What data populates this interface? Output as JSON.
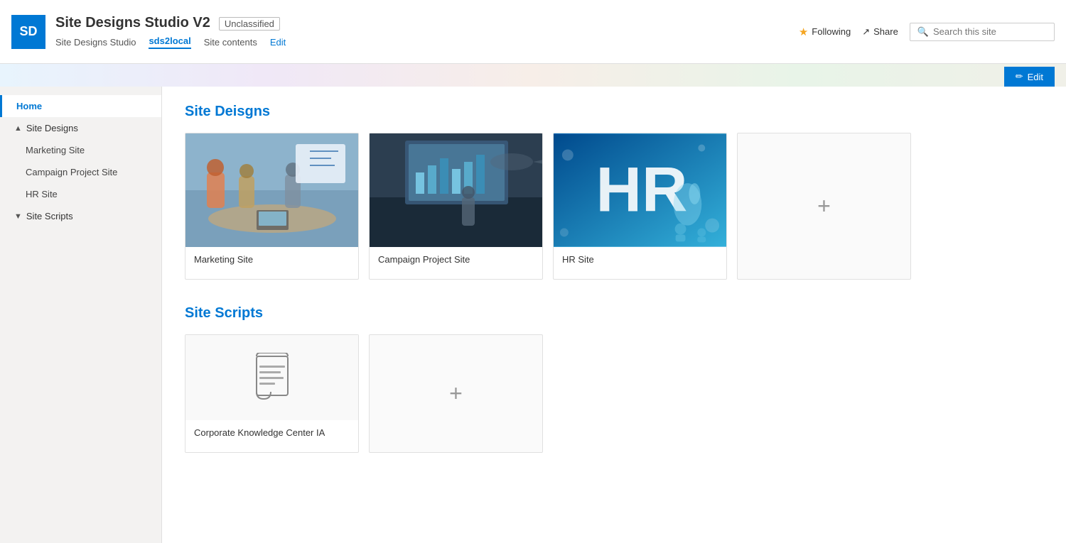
{
  "topBar": {
    "logoText": "SD",
    "logoColor": "#0078d4",
    "siteTitle": "Site Designs Studio V2",
    "siteTag": "Unclassified",
    "navItems": [
      {
        "label": "Site Designs Studio",
        "active": false,
        "edit": false
      },
      {
        "label": "sds2local",
        "active": true,
        "edit": false
      },
      {
        "label": "Site contents",
        "active": false,
        "edit": false
      },
      {
        "label": "Edit",
        "active": false,
        "edit": true
      }
    ],
    "followingLabel": "Following",
    "shareLabel": "Share",
    "searchPlaceholder": "Search this site",
    "editBarLabel": "Edit"
  },
  "sidebar": {
    "items": [
      {
        "label": "Home",
        "active": true,
        "indent": false,
        "toggle": ""
      },
      {
        "label": "Site Designs",
        "active": false,
        "indent": false,
        "toggle": "▲"
      },
      {
        "label": "Marketing Site",
        "active": false,
        "indent": true,
        "toggle": ""
      },
      {
        "label": "Campaign Project Site",
        "active": false,
        "indent": true,
        "toggle": ""
      },
      {
        "label": "HR Site",
        "active": false,
        "indent": true,
        "toggle": ""
      },
      {
        "label": "Site Scripts",
        "active": false,
        "indent": false,
        "toggle": "▼"
      }
    ]
  },
  "main": {
    "siteDesignsTitle": "Site Deisgns",
    "siteScriptsTitle": "Site Scripts",
    "siteDesignCards": [
      {
        "label": "Marketing Site",
        "type": "marketing"
      },
      {
        "label": "Campaign Project Site",
        "type": "campaign"
      },
      {
        "label": "HR Site",
        "type": "hr"
      }
    ],
    "siteScriptCards": [
      {
        "label": "Corporate Knowledge Center IA",
        "type": "script"
      }
    ],
    "addButtonLabel": "+"
  }
}
